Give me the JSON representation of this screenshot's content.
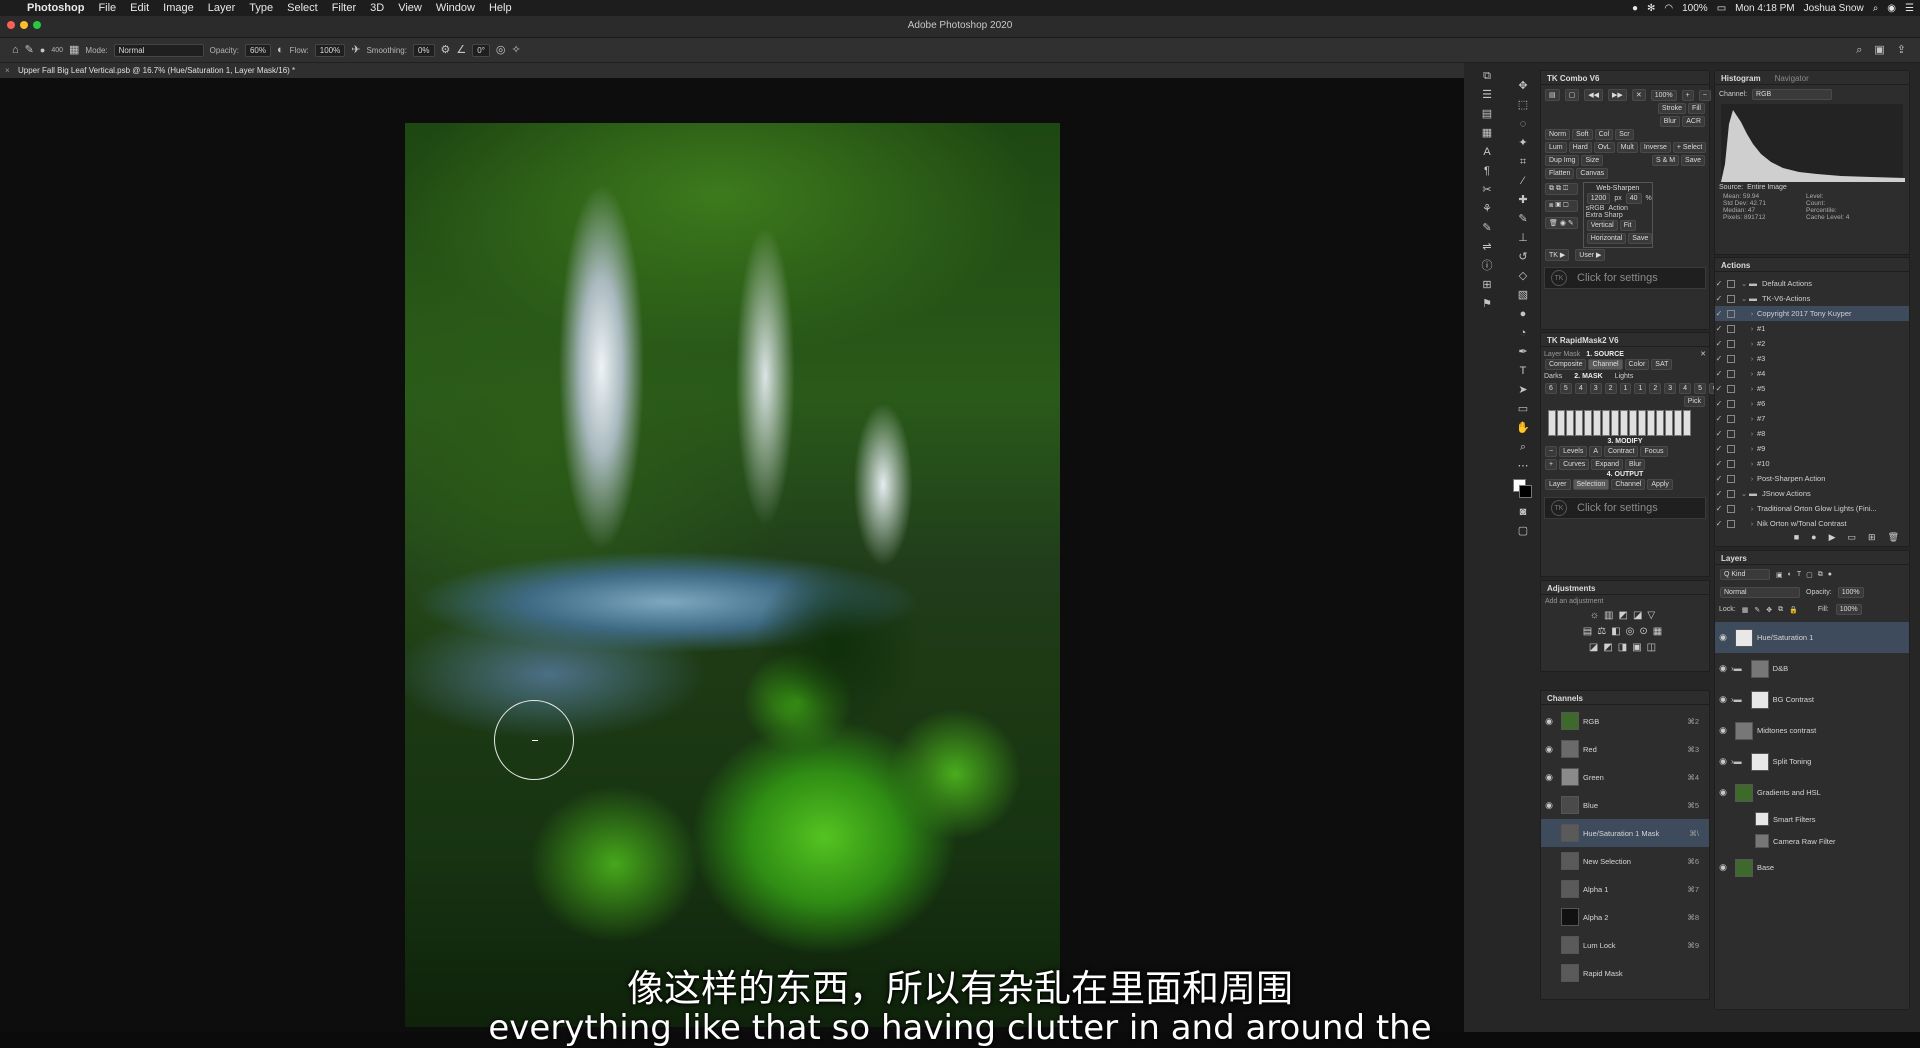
{
  "menubar": {
    "app": "Photoshop",
    "items": [
      "File",
      "Edit",
      "Image",
      "Layer",
      "Type",
      "Select",
      "Filter",
      "3D",
      "View",
      "Window",
      "Help"
    ],
    "battery": "100%",
    "clock": "Mon 4:18 PM",
    "user": "Joshua Snow"
  },
  "window": {
    "title": "Adobe Photoshop 2020"
  },
  "options": {
    "brush_size": "400",
    "mode_label": "Mode:",
    "mode_value": "Normal",
    "opacity_label": "Opacity:",
    "opacity_value": "60%",
    "flow_label": "Flow:",
    "flow_value": "100%",
    "smoothing_label": "Smoothing:",
    "smoothing_value": "0%",
    "angle_value": "0°"
  },
  "document": {
    "tab": "Upper Fall Big Leaf Vertical.psb @ 16.7% (Hue/Saturation 1, Layer Mask/16) *"
  },
  "subtitle": {
    "zh": "像这样的东西，所以有杂乱在里面和周围",
    "en": "everything like that so having clutter in and around the"
  },
  "tk_combo": {
    "title": "TK Combo V6",
    "zoom": "100%",
    "rows": [
      [
        "Stroke",
        "Fill"
      ],
      [
        "Blur",
        "ACR"
      ],
      [
        "Norm",
        "Soft",
        "Col",
        "Scr"
      ],
      [
        "Lum",
        "Hard",
        "OvL",
        "Mult",
        "Inverse",
        "+ Select"
      ],
      [
        "Dup Img",
        "Size",
        "S & M",
        "Save"
      ],
      [
        "Flatten",
        "Canvas"
      ]
    ],
    "websharpen": {
      "title": "Web-Sharpen",
      "px_value": "1200",
      "px_unit": "px",
      "pct_value": "40",
      "pct_unit": "%",
      "srgb": "sRGB",
      "action": "Action",
      "extra": "Extra Sharp",
      "vertical": "Vertical",
      "fit": "Fit",
      "horizontal": "Horizontal",
      "save": "Save"
    },
    "tk_label": "TK ▶",
    "user_label": "User ▶",
    "settings": "Click for settings",
    "tk_logo": "TK"
  },
  "rapidmask": {
    "title": "TK RapidMask2 V6",
    "layer_mask": "Layer Mask",
    "source": "1. SOURCE",
    "source_tabs": [
      "Composite",
      "Channel",
      "Color",
      "SAT"
    ],
    "darks": "Darks",
    "mask": "2. MASK",
    "lights": "Lights",
    "nums": [
      "6",
      "5",
      "4",
      "3",
      "2",
      "1",
      "1",
      "2",
      "3",
      "4",
      "5",
      "6"
    ],
    "pick": "Pick",
    "modify": "3. MODIFY",
    "modify_row1": [
      "Levels",
      "A",
      "Contract",
      "Focus"
    ],
    "modify_row2": [
      "Curves",
      "Expand",
      "Blur"
    ],
    "output": "4. OUTPUT",
    "output_btns": [
      "Layer",
      "Selection",
      "Channel",
      "Apply"
    ],
    "settings": "Click for settings",
    "tk_logo": "TK"
  },
  "adjustments": {
    "title": "Adjustments",
    "hint": "Add an adjustment"
  },
  "channels": {
    "title": "Channels",
    "items": [
      {
        "name": "RGB",
        "key": "⌘2"
      },
      {
        "name": "Red",
        "key": "⌘3"
      },
      {
        "name": "Green",
        "key": "⌘4"
      },
      {
        "name": "Blue",
        "key": "⌘5"
      },
      {
        "name": "Hue/Saturation 1 Mask",
        "key": "⌘\\"
      },
      {
        "name": "New Selection",
        "key": "⌘6"
      },
      {
        "name": "Alpha 1",
        "key": "⌘7"
      },
      {
        "name": "Alpha 2",
        "key": "⌘8"
      },
      {
        "name": "Lum Lock",
        "key": "⌘9"
      },
      {
        "name": "Rapid Mask",
        "key": ""
      }
    ]
  },
  "histogram": {
    "tabs": [
      "Histogram",
      "Navigator"
    ],
    "channel_label": "Channel:",
    "channel_value": "RGB",
    "source_label": "Source:",
    "source_value": "Entire Image",
    "stats_left": [
      "Mean: 59.94",
      "Std Dev: 42.71",
      "Median: 47",
      "Pixels: 891712"
    ],
    "stats_right": [
      "Level:",
      "Count:",
      "Percentile:",
      "Cache Level: 4"
    ]
  },
  "actions": {
    "title": "Actions",
    "items": [
      {
        "label": "Default Actions",
        "folder": true,
        "indent": 0
      },
      {
        "label": "TK-V6-Actions",
        "folder": true,
        "indent": 0
      },
      {
        "label": "Copyright 2017 Tony Kuyper",
        "folder": false,
        "indent": 1,
        "highlight": true
      },
      {
        "label": "#1",
        "folder": false,
        "indent": 1
      },
      {
        "label": "#2",
        "folder": false,
        "indent": 1
      },
      {
        "label": "#3",
        "folder": false,
        "indent": 1
      },
      {
        "label": "#4",
        "folder": false,
        "indent": 1
      },
      {
        "label": "#5",
        "folder": false,
        "indent": 1
      },
      {
        "label": "#6",
        "folder": false,
        "indent": 1
      },
      {
        "label": "#7",
        "folder": false,
        "indent": 1
      },
      {
        "label": "#8",
        "folder": false,
        "indent": 1
      },
      {
        "label": "#9",
        "folder": false,
        "indent": 1
      },
      {
        "label": "#10",
        "folder": false,
        "indent": 1
      },
      {
        "label": "Post-Sharpen Action",
        "folder": false,
        "indent": 1
      },
      {
        "label": "JSnow Actions",
        "folder": true,
        "indent": 0
      },
      {
        "label": "Traditional Orton Glow Lights (Fini...",
        "folder": false,
        "indent": 1
      },
      {
        "label": "Nik Orton w/Tonal Contrast",
        "folder": false,
        "indent": 1
      }
    ]
  },
  "layers": {
    "title": "Layers",
    "kind": "Q Kind",
    "blend": "Normal",
    "opacity_label": "Opacity:",
    "opacity": "100%",
    "lock_label": "Lock:",
    "fill_label": "Fill:",
    "fill": "100%",
    "items": [
      {
        "name": "Hue/Saturation 1",
        "selected": true
      },
      {
        "name": "D&B",
        "folder": true
      },
      {
        "name": "BG Contrast",
        "folder": true
      },
      {
        "name": "Midtones contrast",
        "folder": false
      },
      {
        "name": "Split Toning",
        "folder": true
      },
      {
        "name": "Gradients and HSL",
        "folder": false
      },
      {
        "name": "Smart Filters",
        "folder": false,
        "sub": true
      },
      {
        "name": "Camera Raw Filter",
        "folder": false,
        "sub": true
      },
      {
        "name": "Base",
        "folder": false
      }
    ]
  }
}
